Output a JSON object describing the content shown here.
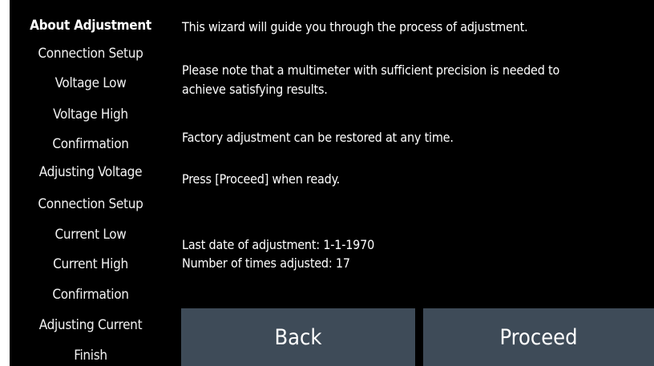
{
  "sidebar": {
    "items": [
      {
        "label": "About Adjustment",
        "active": true
      },
      {
        "label": "Connection Setup"
      },
      {
        "label": "Voltage Low"
      },
      {
        "label": "Voltage High"
      },
      {
        "label": "Confirmation"
      },
      {
        "label": "Adjusting Voltage"
      },
      {
        "label": "Connection Setup"
      },
      {
        "label": "Current Low"
      },
      {
        "label": "Current High"
      },
      {
        "label": "Confirmation"
      },
      {
        "label": "Adjusting Current"
      },
      {
        "label": "Finish"
      }
    ]
  },
  "content": {
    "intro": "This wizard will guide you through the process of adjustment.",
    "note_line1": "Please note that a multimeter with sufficient precision is needed to",
    "note_line2": "achieve satisfying results.",
    "restore": "Factory adjustment can be restored at any time.",
    "prompt": "Press [Proceed] when ready.",
    "last_date": "Last date of adjustment: 1-1-1970",
    "times_adjusted": "Number of times adjusted: 17"
  },
  "buttons": {
    "back": "Back",
    "proceed": "Proceed"
  },
  "colors": {
    "background": "#000000",
    "button": "#3e4b58",
    "text": "#ffffff"
  }
}
